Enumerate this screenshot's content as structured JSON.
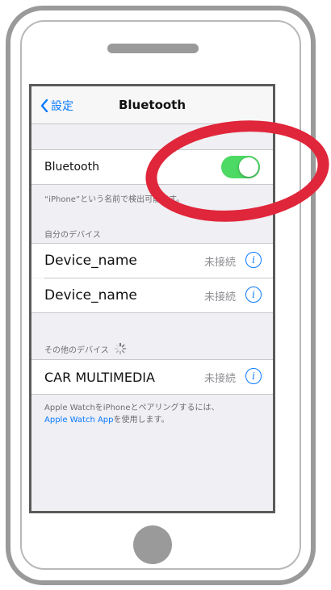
{
  "nav": {
    "back_label": "設定",
    "title": "Bluetooth"
  },
  "bluetooth_row": {
    "label": "Bluetooth",
    "toggle_on": true
  },
  "discoverable_caption": "“iPhone”という名前で検出可能です。",
  "my_devices": {
    "header": "自分のデバイス",
    "items": [
      {
        "name": "Device_name",
        "status": "未接続",
        "info": "i"
      },
      {
        "name": "Device_name",
        "status": "未接続",
        "info": "i"
      }
    ]
  },
  "other_devices": {
    "header": "その他のデバイス",
    "items": [
      {
        "name": "CAR MULTIMEDIA",
        "status": "未接続",
        "info": "i"
      }
    ]
  },
  "footer": {
    "line1": "Apple WatchをiPhoneとペアリングするには、",
    "link": "Apple Watch App",
    "line2_suffix": "を使用します。"
  },
  "colors": {
    "accent": "#0a7aff",
    "toggle_on": "#4cd964",
    "annotation": "#e0263a"
  },
  "icons": {
    "back": "chevron-left-icon",
    "info": "info-circle-icon",
    "spinner": "activity-spinner-icon"
  }
}
